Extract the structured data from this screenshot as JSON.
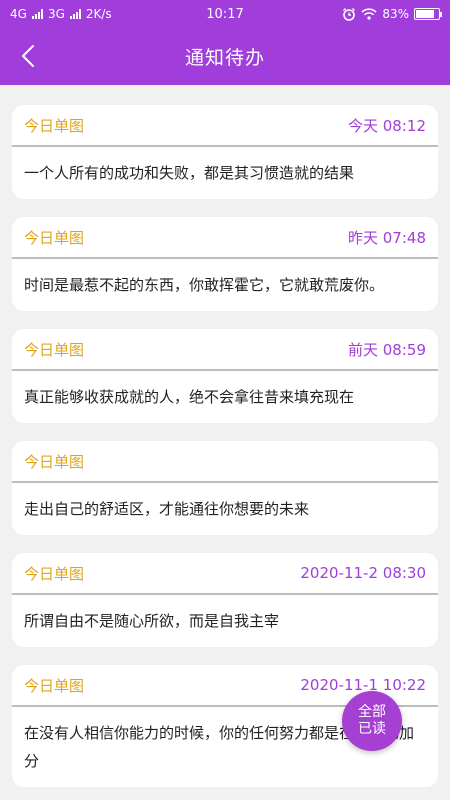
{
  "status": {
    "net1": "4G",
    "net2": "3G",
    "speed": "2K/s",
    "time": "10:17",
    "battery": "83%",
    "battery_level": 0.83
  },
  "header": {
    "title": "通知待办",
    "back_icon": "chevron-left-icon"
  },
  "notifications": [
    {
      "source": "今日单图",
      "time": "今天 08:12",
      "text": "一个人所有的成功和失败，都是其习惯造就的结果"
    },
    {
      "source": "今日单图",
      "time": "昨天 07:48",
      "text": "时间是最惹不起的东西，你敢挥霍它，它就敢荒废你。"
    },
    {
      "source": "今日单图",
      "time": "前天 08:59",
      "text": "真正能够收获成就的人，绝不会拿往昔来填充现在"
    },
    {
      "source": "今日单图",
      "time": "",
      "text": "走出自己的舒适区，才能通往你想要的未来"
    },
    {
      "source": "今日单图",
      "time": "2020-11-2 08:30",
      "text": "所谓自由不是随心所欲，而是自我主宰"
    },
    {
      "source": "今日单图",
      "time": "2020-11-1 10:22",
      "text": "在没有人相信你能力的时候，你的任何努力都是在为自己加分"
    }
  ],
  "fab": {
    "line1": "全部",
    "line2": "已读"
  },
  "colors": {
    "accent": "#a03ddb",
    "source": "#e0a418",
    "background": "#f1f1f1"
  }
}
